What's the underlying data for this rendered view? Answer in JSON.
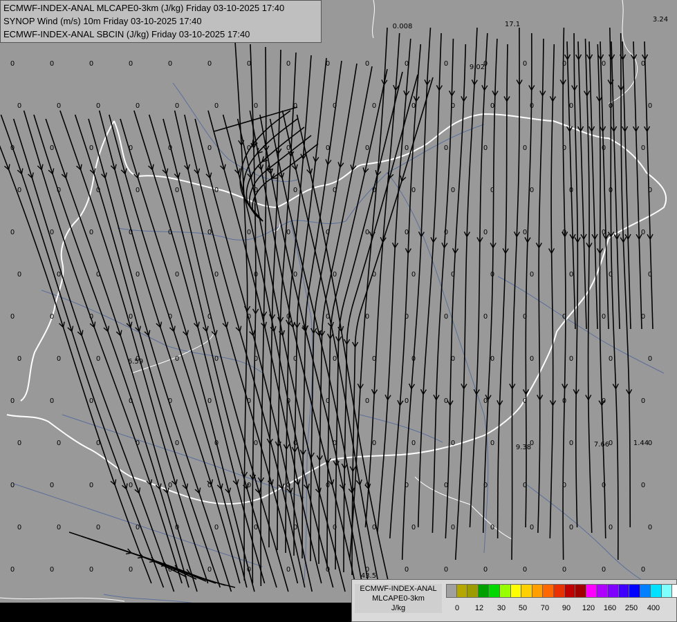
{
  "title_lines": [
    "ECMWF-INDEX-ANAL MLCAPE0-3km (J/kg) Friday 03-10-2025 17:40",
    "SYNOP Wind (m/s) 10m Friday 03-10-2025 17:40",
    "ECMWF-INDEX-ANAL SBCIN (J/kg) Friday 03-10-2025 17:40"
  ],
  "colors": {
    "background": "#999999",
    "border": "#ffffff",
    "rivers": "#5a6f9a",
    "streamlines": "#000000"
  },
  "legend": {
    "title_lines": [
      "ECMWF-INDEX-ANAL",
      "MLCAPE0-3km",
      "J/kg"
    ],
    "swatch_colors": [
      "#a0a0a0",
      "#b4a800",
      "#9c9c00",
      "#00a000",
      "#00d800",
      "#98ff00",
      "#ffff00",
      "#ffd000",
      "#ffa000",
      "#ff6800",
      "#e83000",
      "#c00000",
      "#a00000",
      "#ff00ff",
      "#b000ff",
      "#8000ff",
      "#4000ff",
      "#0000ff",
      "#0080ff",
      "#00e0ff",
      "#80ffff",
      "#ffffff"
    ],
    "tick_labels": [
      "0",
      "12",
      "30",
      "50",
      "70",
      "90",
      "120",
      "160",
      "250",
      "400"
    ]
  },
  "station_labels": {
    "special": [
      "0.008",
      "17.1",
      "3.24",
      "9.02",
      "6.59",
      "9.38",
      "7.66",
      "1.44",
      "43.5"
    ]
  }
}
